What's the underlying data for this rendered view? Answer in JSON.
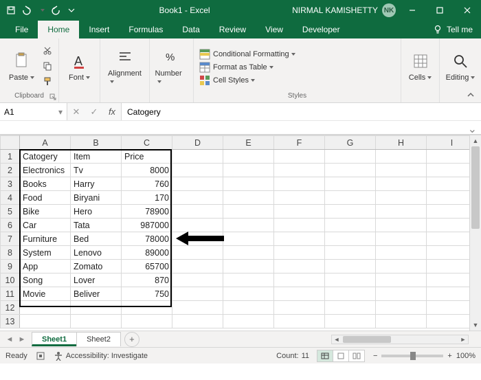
{
  "titlebar": {
    "title": "Book1 - Excel",
    "user_name": "NIRMAL KAMISHETTY",
    "user_initials": "NK"
  },
  "tabs": {
    "file": "File",
    "home": "Home",
    "insert": "Insert",
    "formulas": "Formulas",
    "data": "Data",
    "review": "Review",
    "view": "View",
    "developer": "Developer",
    "tellme": "Tell me"
  },
  "ribbon": {
    "clipboard": {
      "label": "Clipboard",
      "paste": "Paste"
    },
    "font": {
      "label": "Font"
    },
    "alignment": {
      "label": "Alignment"
    },
    "number": {
      "label": "Number"
    },
    "styles": {
      "label": "Styles",
      "conditional": "Conditional Formatting",
      "table": "Format as Table",
      "cell": "Cell Styles"
    },
    "cells": {
      "label": "Cells"
    },
    "editing": {
      "label": "Editing"
    }
  },
  "formula": {
    "name_box": "A1",
    "value": "Catogery"
  },
  "grid": {
    "columns": [
      "A",
      "B",
      "C",
      "D",
      "E",
      "F",
      "G",
      "H",
      "I"
    ],
    "rows": [
      {
        "n": "1",
        "a": "Catogery",
        "b": "Item",
        "c_label": "Price",
        "c": ""
      },
      {
        "n": "2",
        "a": "Electronics",
        "b": "Tv",
        "c": "8000"
      },
      {
        "n": "3",
        "a": "Books",
        "b": "Harry",
        "c": "760"
      },
      {
        "n": "4",
        "a": "Food",
        "b": "Biryani",
        "c": "170"
      },
      {
        "n": "5",
        "a": "Bike",
        "b": "Hero",
        "c": "78900"
      },
      {
        "n": "6",
        "a": "Car",
        "b": "Tata",
        "c": "987000"
      },
      {
        "n": "7",
        "a": "Furniture",
        "b": "Bed",
        "c": "78000"
      },
      {
        "n": "8",
        "a": "System",
        "b": "Lenovo",
        "c": "89000"
      },
      {
        "n": "9",
        "a": "App",
        "b": "Zomato",
        "c": "65700"
      },
      {
        "n": "10",
        "a": "Song",
        "b": "Lover",
        "c": "870"
      },
      {
        "n": "11",
        "a": "Movie",
        "b": "Beliver",
        "c": "750"
      },
      {
        "n": "12",
        "a": "",
        "b": "",
        "c": ""
      },
      {
        "n": "13",
        "a": "",
        "b": "",
        "c": ""
      }
    ]
  },
  "sheets": {
    "sheet1": "Sheet1",
    "sheet2": "Sheet2"
  },
  "status": {
    "ready": "Ready",
    "accessibility": "Accessibility: Investigate",
    "count_label": "Count:",
    "count_value": "11",
    "zoom": "100%"
  }
}
